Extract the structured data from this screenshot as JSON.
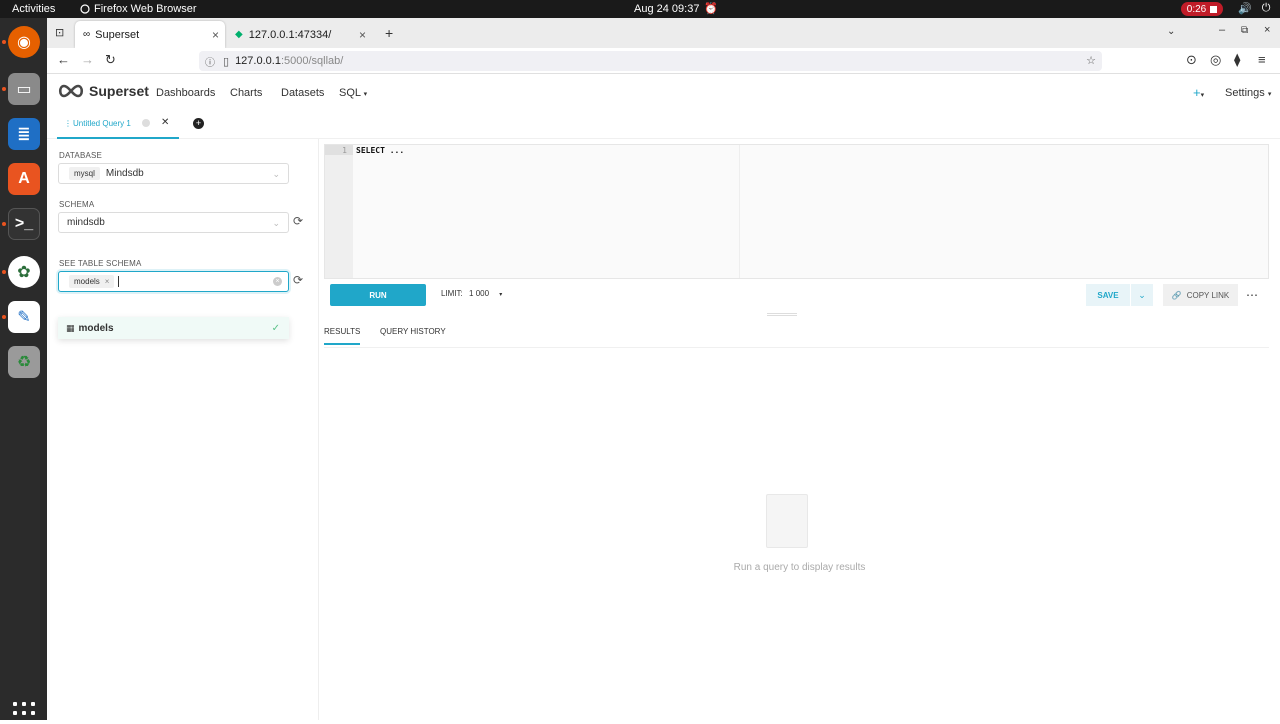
{
  "topbar": {
    "activities": "Activities",
    "app_name": "Firefox Web Browser",
    "clock": "Aug 24  09:37",
    "recording": "0:26"
  },
  "browser": {
    "tabs": [
      {
        "title": "Superset"
      },
      {
        "title": "127.0.0.1:47334/"
      }
    ],
    "url_host": "127.0.0.1",
    "url_path": ":5000/sqllab/"
  },
  "superset": {
    "brand": "Superset",
    "nav": [
      "Dashboards",
      "Charts",
      "Datasets",
      "SQL"
    ],
    "plus": "+",
    "settings": "Settings",
    "query_tab": "Untitled Query 1",
    "database_label": "DATABASE",
    "database_tag": "mysql",
    "database_value": "Mindsdb",
    "schema_label": "SCHEMA",
    "schema_value": "mindsdb",
    "table_schema_label": "SEE TABLE SCHEMA",
    "table_tag": "models",
    "dropdown_option": "models",
    "editor_line": "1",
    "editor_code": "SELECT ...",
    "run_label": "RUN",
    "limit_label": "LIMIT:",
    "limit_value": "1 000",
    "save_label": "SAVE",
    "copy_link_label": "COPY LINK",
    "results_tab": "RESULTS",
    "history_tab": "QUERY HISTORY",
    "empty_text": "Run a query to display results"
  },
  "colors": {
    "accent": "#20a7c9",
    "dock": "#2b2b2b",
    "topbar": "#1a1a1a"
  }
}
